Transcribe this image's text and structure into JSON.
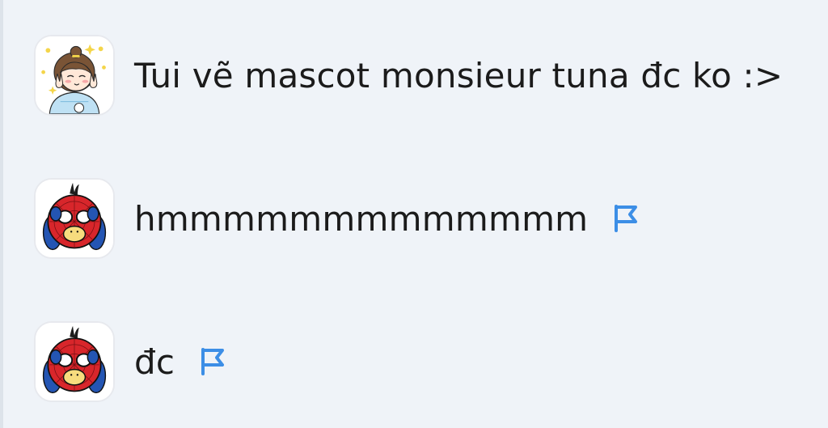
{
  "messages": [
    {
      "avatar_icon": "girl-peace-sign-avatar-icon",
      "text": "Tui vẽ mascot monsieur tuna đc ko :>",
      "flagged": false
    },
    {
      "avatar_icon": "spider-duck-avatar-icon",
      "text": "hmmmmmmmmmmmmm",
      "flagged": true,
      "flag_icon": "flag-icon"
    },
    {
      "avatar_icon": "spider-duck-avatar-icon",
      "text": "đc",
      "flagged": true,
      "flag_icon": "flag-icon"
    }
  ],
  "colors": {
    "background": "#eff3f8",
    "text": "#1b1b1b",
    "flag": "#3c8ee6"
  }
}
